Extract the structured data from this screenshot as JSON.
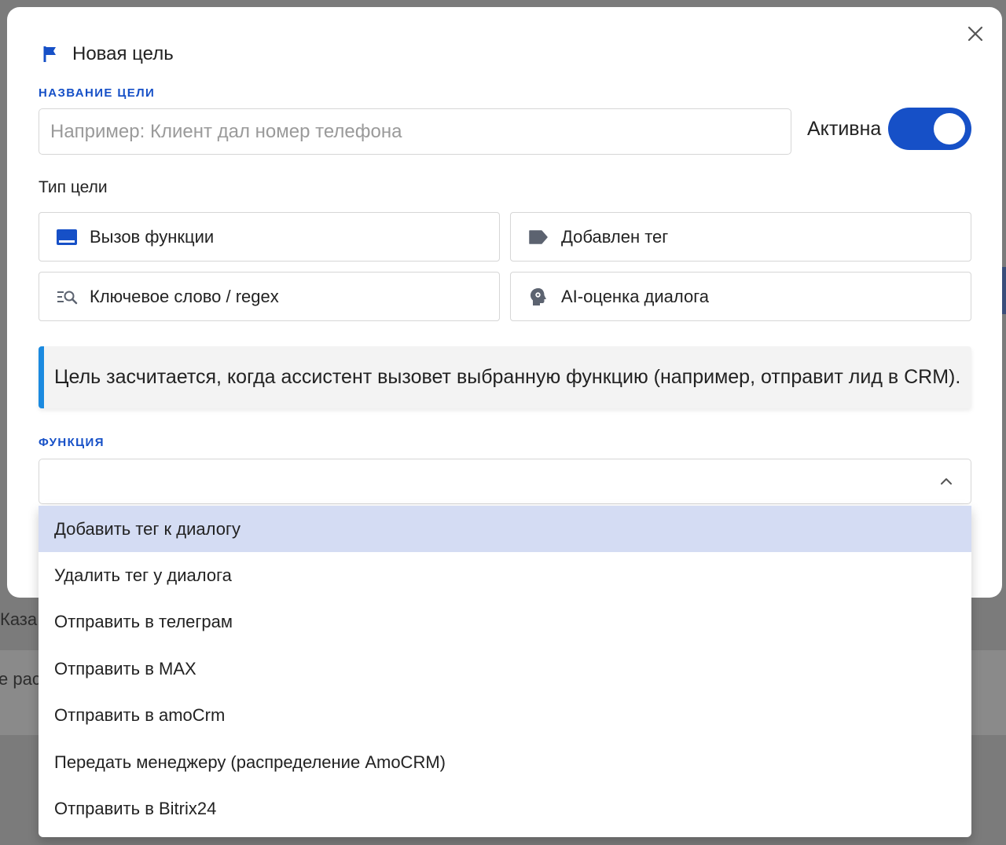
{
  "background": {
    "fragments": [
      "Каза",
      "е рас"
    ]
  },
  "modal": {
    "title": "Новая цель",
    "goal_name_label": "НАЗВАНИЕ ЦЕЛИ",
    "goal_name_placeholder": "Например: Клиент дал номер телефона",
    "goal_name_value": "",
    "active_label": "Активна",
    "active_toggle_on": true,
    "goal_type_label": "Тип цели",
    "goal_types": [
      {
        "label": "Вызов функции",
        "icon": "function-window-icon",
        "selected": true
      },
      {
        "label": "Добавлен тег",
        "icon": "tag-icon",
        "selected": false
      },
      {
        "label": "Ключевое слово / regex",
        "icon": "keyword-search-icon",
        "selected": false
      },
      {
        "label": "AI-оценка диалога",
        "icon": "ai-head-icon",
        "selected": false
      }
    ],
    "info_text": "Цель засчитается, когда ассистент вызовет выбранную функцию (например, отправит лид в CRM).",
    "function_label": "ФУНКЦИЯ",
    "function_value": "",
    "function_options": [
      "Добавить тег к диалогу",
      "Удалить тег у диалога",
      "Отправить в телеграм",
      "Отправить в MAX",
      "Отправить в amoCrm",
      "Передать менеджеру (распределение AmoCRM)",
      "Отправить в Bitrix24"
    ],
    "highlighted_option_index": 0
  },
  "colors": {
    "accent": "#1650c7",
    "info_border": "#1b8ae0",
    "highlight": "#d4dcf3",
    "overlay": "#7b7b7b"
  }
}
